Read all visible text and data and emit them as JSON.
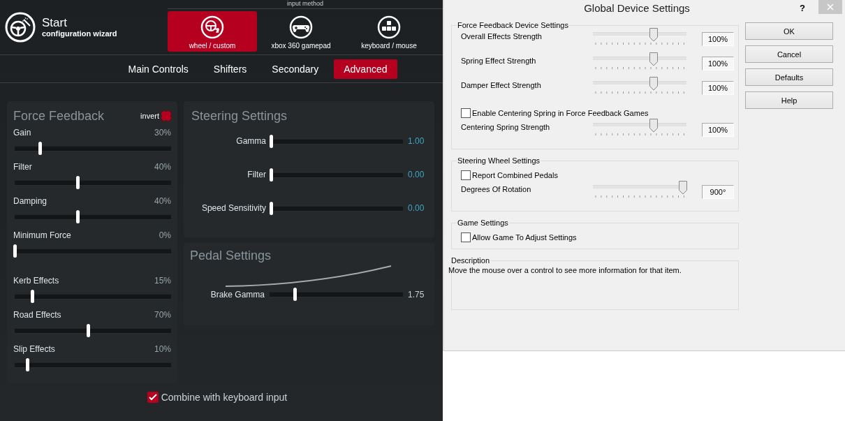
{
  "wizard": {
    "title": "Start",
    "subtitle": "configuration wizard",
    "input_method_label": "input method",
    "input_methods": [
      {
        "label": "wheel / custom",
        "kind": "wheel",
        "selected": true
      },
      {
        "label": "xbox 360 gamepad",
        "kind": "gamepad",
        "selected": false
      },
      {
        "label": "keyboard / mouse",
        "kind": "keyboard",
        "selected": false
      }
    ],
    "tabs": [
      {
        "label": "Main Controls",
        "selected": false
      },
      {
        "label": "Shifters",
        "selected": false
      },
      {
        "label": "Secondary",
        "selected": false
      },
      {
        "label": "Advanced",
        "selected": true
      }
    ],
    "force_feedback": {
      "title": "Force Feedback",
      "invert_label": "invert",
      "invert_checked": true,
      "sliders": [
        {
          "label": "Gain",
          "value": "30%",
          "level": 0.16
        },
        {
          "label": "Filter",
          "value": "40%",
          "level": 0.4
        },
        {
          "label": "Damping",
          "value": "40%",
          "level": 0.4
        },
        {
          "label": "Minimum Force",
          "value": "0%",
          "level": 0
        },
        {
          "label": "Kerb Effects",
          "value": "15%",
          "level": 0.11
        },
        {
          "label": "Road Effects",
          "value": "70%",
          "level": 0.47
        },
        {
          "label": "Slip Effects",
          "value": "10%",
          "level": 0.08
        }
      ]
    },
    "steering": {
      "title": "Steering Settings",
      "sliders": [
        {
          "label": "Gamma",
          "value": "1.00",
          "level": 0
        },
        {
          "label": "Filter",
          "value": "0.00",
          "level": 0
        },
        {
          "label": "Speed Sensitivity",
          "value": "0.00",
          "level": 0
        }
      ]
    },
    "pedal": {
      "title": "Pedal Settings",
      "slider": {
        "label": "Brake Gamma",
        "value": "1.75",
        "level": 0.19
      }
    },
    "combine_keyboard": {
      "label": "Combine with keyboard input",
      "checked": true
    }
  },
  "dialog": {
    "title": "Global Device Settings",
    "help_glyph": "?",
    "groups": [
      {
        "title": "Force Feedback Device Settings",
        "items": [
          {
            "kind": "slider",
            "label": "Overall Effects Strength",
            "value": "100%",
            "level": 0.65
          },
          {
            "kind": "slider",
            "label": "Spring Effect Strength",
            "value": "100%",
            "level": 0.65
          },
          {
            "kind": "slider",
            "label": "Damper Effect Strength",
            "value": "100%",
            "level": 0.65
          },
          {
            "kind": "checkbox",
            "label": "Enable Centering Spring in Force Feedback Games",
            "checked": false
          },
          {
            "kind": "slider",
            "label": "Centering Spring Strength",
            "value": "100%",
            "level": 0.65
          }
        ]
      },
      {
        "title": "Steering Wheel Settings",
        "items": [
          {
            "kind": "checkbox",
            "label": "Report Combined Pedals",
            "checked": false
          },
          {
            "kind": "slider",
            "label": "Degrees Of Rotation",
            "value": "900°",
            "level": 0.96
          }
        ]
      },
      {
        "title": "Game Settings",
        "items": [
          {
            "kind": "checkbox",
            "label": "Allow Game To Adjust Settings",
            "checked": false
          }
        ]
      }
    ],
    "description": {
      "title": "Description",
      "text": "Move the mouse over a control to see more information for that item."
    },
    "buttons": [
      "OK",
      "Cancel",
      "Defaults",
      "Help"
    ]
  }
}
